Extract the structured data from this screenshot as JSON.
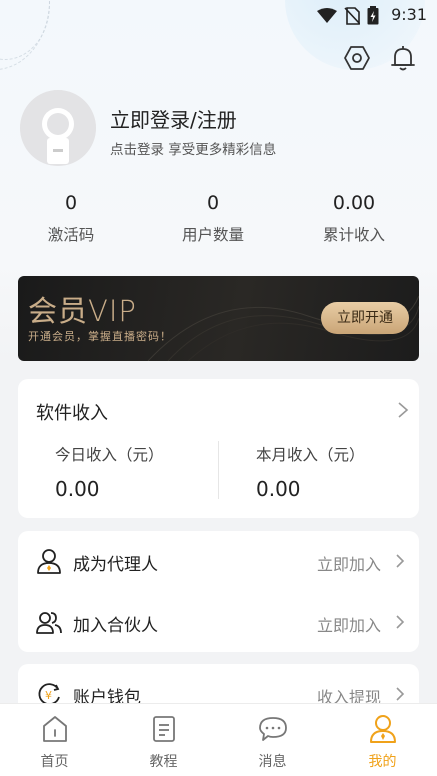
{
  "status_bar": {
    "time": "9:31"
  },
  "profile": {
    "title": "立即登录/注册",
    "subtitle": "点击登录 享受更多精彩信息"
  },
  "stats": [
    {
      "value": "0",
      "label": "激活码"
    },
    {
      "value": "0",
      "label": "用户数量"
    },
    {
      "value": "0.00",
      "label": "累计收入"
    }
  ],
  "vip": {
    "title": "会员VIP",
    "subtitle": "开通会员，掌握直播密码！",
    "button": "立即开通"
  },
  "income": {
    "title": "软件收入",
    "today": {
      "label": "今日收入（元）",
      "value": "0.00"
    },
    "month": {
      "label": "本月收入（元）",
      "value": "0.00"
    }
  },
  "join": [
    {
      "label": "成为代理人",
      "action": "立即加入"
    },
    {
      "label": "加入合伙人",
      "action": "立即加入"
    }
  ],
  "wallet": {
    "label": "账户钱包",
    "action": "收入提现"
  },
  "tabbar": [
    {
      "label": "首页",
      "icon": "home-icon"
    },
    {
      "label": "教程",
      "icon": "document-icon"
    },
    {
      "label": "消息",
      "icon": "message-icon"
    },
    {
      "label": "我的",
      "icon": "user-icon",
      "active": true
    }
  ],
  "colors": {
    "accent": "#f0a21a",
    "vip_gold": "#c9ad89",
    "vip_bg": "#1a1a1a"
  }
}
